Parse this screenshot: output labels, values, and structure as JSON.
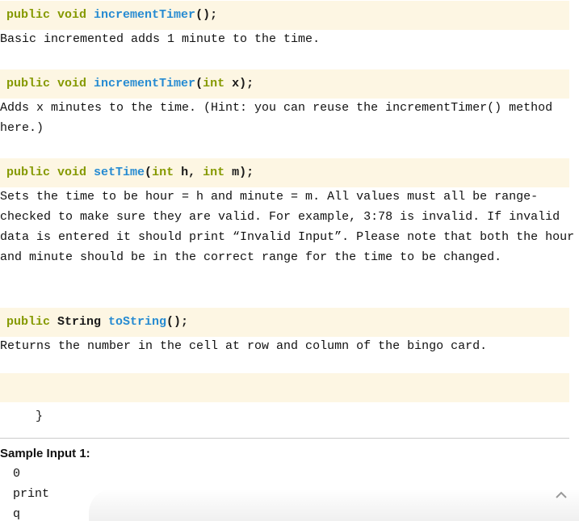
{
  "methods": [
    {
      "signature": [
        {
          "text": "public void ",
          "kind": "kw"
        },
        {
          "text": "incrementTimer",
          "kind": "fn"
        },
        {
          "text": "();",
          "kind": "plain"
        }
      ],
      "description": "Basic incremented adds 1 minute to the time."
    },
    {
      "signature": [
        {
          "text": "public void ",
          "kind": "kw"
        },
        {
          "text": "incrementTimer",
          "kind": "fn"
        },
        {
          "text": "(",
          "kind": "plain"
        },
        {
          "text": "int",
          "kind": "kw"
        },
        {
          "text": " x);",
          "kind": "plain"
        }
      ],
      "description": "Adds x minutes to the time. (Hint: you can reuse the incrementTimer() method here.)"
    },
    {
      "signature": [
        {
          "text": "public void ",
          "kind": "kw"
        },
        {
          "text": "setTime",
          "kind": "fn"
        },
        {
          "text": "(",
          "kind": "plain"
        },
        {
          "text": "int",
          "kind": "kw"
        },
        {
          "text": " h, ",
          "kind": "plain"
        },
        {
          "text": "int",
          "kind": "kw"
        },
        {
          "text": " m);",
          "kind": "plain"
        }
      ],
      "description": "Sets the time to be hour = h and minute = m. All values must all be range-checked to make sure they are valid. For example, 3:78 is invalid. If invalid data is entered it should print “Invalid Input”. Please note that both the hour and minute should be in the correct range for the time to be changed."
    },
    {
      "signature": [
        {
          "text": "public ",
          "kind": "kw"
        },
        {
          "text": "String ",
          "kind": "plain"
        },
        {
          "text": "toString",
          "kind": "fn"
        },
        {
          "text": "();",
          "kind": "plain"
        }
      ],
      "description": "Returns the number in the cell at row and column of the bingo card."
    }
  ],
  "closing_brace": "}",
  "sample": {
    "title": "Sample Input 1:",
    "lines": [
      "0",
      "print",
      "q"
    ]
  },
  "colors": {
    "code_bg": "#fdf6e3",
    "keyword": "#859900",
    "function": "#268bd2"
  },
  "icons": {
    "scroll_top": "chevron-up-icon"
  }
}
